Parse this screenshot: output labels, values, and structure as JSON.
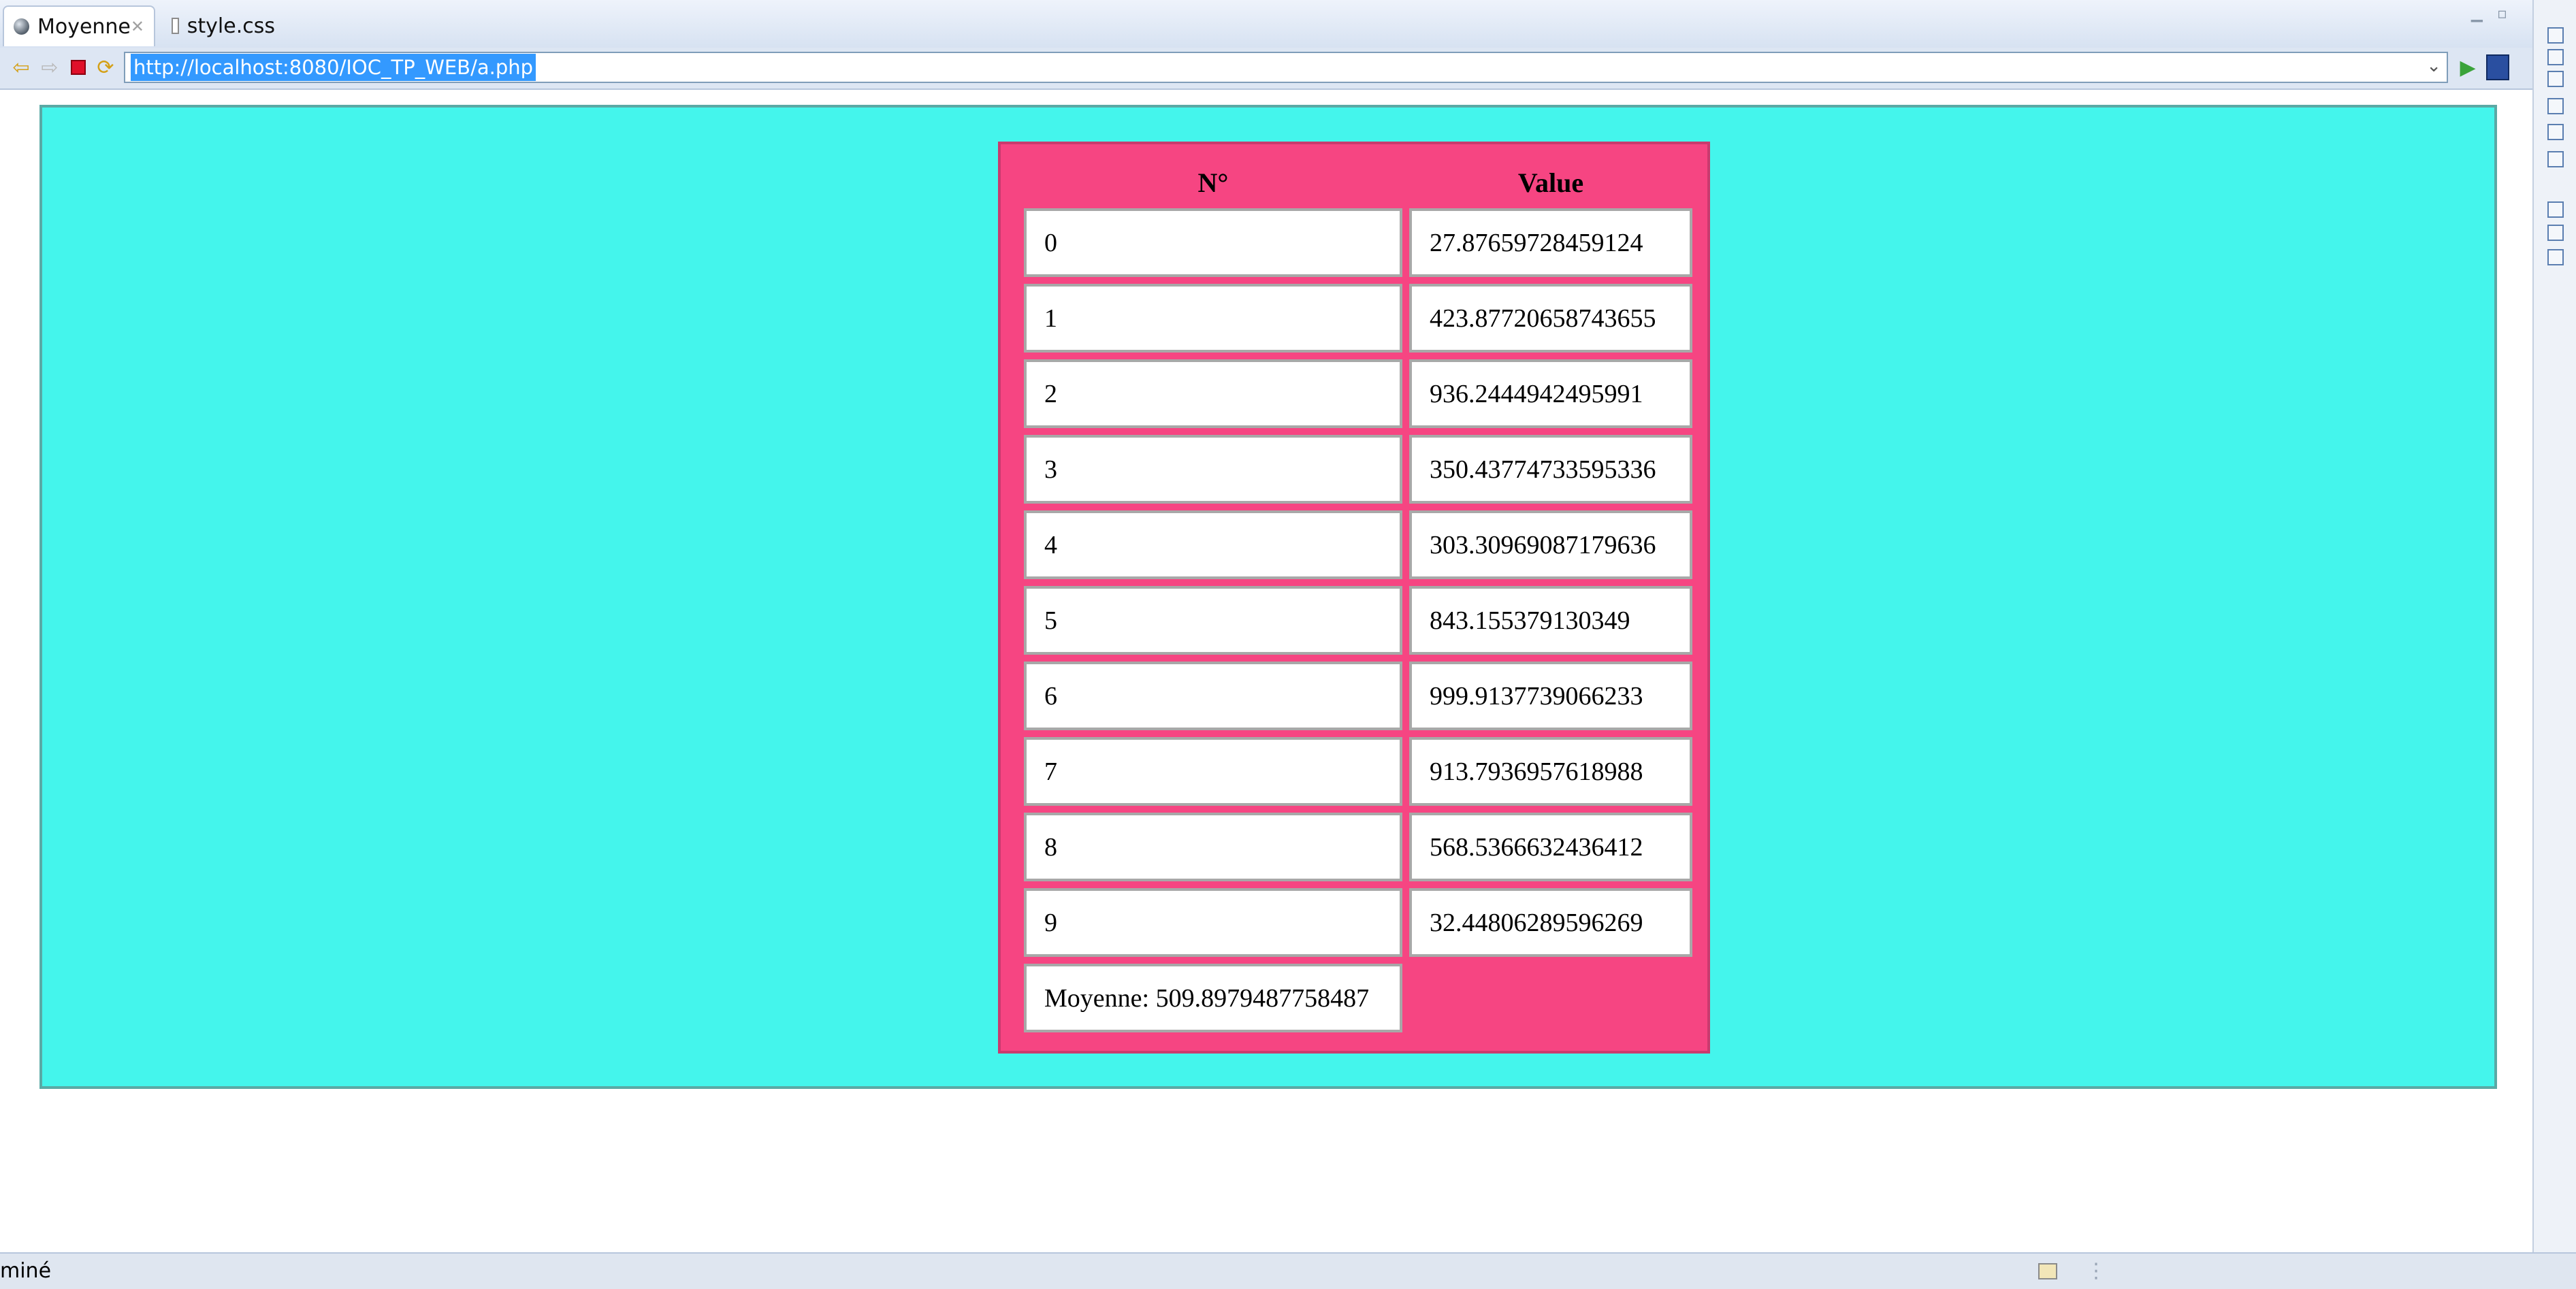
{
  "tabs": [
    {
      "label": "Moyenne",
      "active": true
    },
    {
      "label": "style.css",
      "active": false
    }
  ],
  "toolbar": {
    "url": "http://localhost:8080/IOC_TP_WEB/a.php",
    "back_icon": "arrow-left-icon",
    "forward_icon": "arrow-right-icon",
    "stop_icon": "stop-icon",
    "refresh_icon": "refresh-icon",
    "go_icon": "go-arrow-icon",
    "extra_icon": "browser-menu-icon"
  },
  "table": {
    "headers": [
      "N°",
      "Value"
    ],
    "rows": [
      {
        "n": "0",
        "value": "27.87659728459124"
      },
      {
        "n": "1",
        "value": "423.87720658743655"
      },
      {
        "n": "2",
        "value": "936.2444942495991"
      },
      {
        "n": "3",
        "value": "350.43774733595336"
      },
      {
        "n": "4",
        "value": "303.30969087179636"
      },
      {
        "n": "5",
        "value": "843.155379130349"
      },
      {
        "n": "6",
        "value": "999.9137739066233"
      },
      {
        "n": "7",
        "value": "913.7936957618988"
      },
      {
        "n": "8",
        "value": "568.5366632436412"
      },
      {
        "n": "9",
        "value": "32.44806289596269"
      }
    ],
    "average": "Moyenne: 509.8979487758487"
  },
  "status": {
    "text": "miné"
  },
  "colors": {
    "page_background": "#44f5ec",
    "table_background": "#f64582",
    "cell_background": "#ffffff",
    "url_selection": "#3399ff"
  }
}
